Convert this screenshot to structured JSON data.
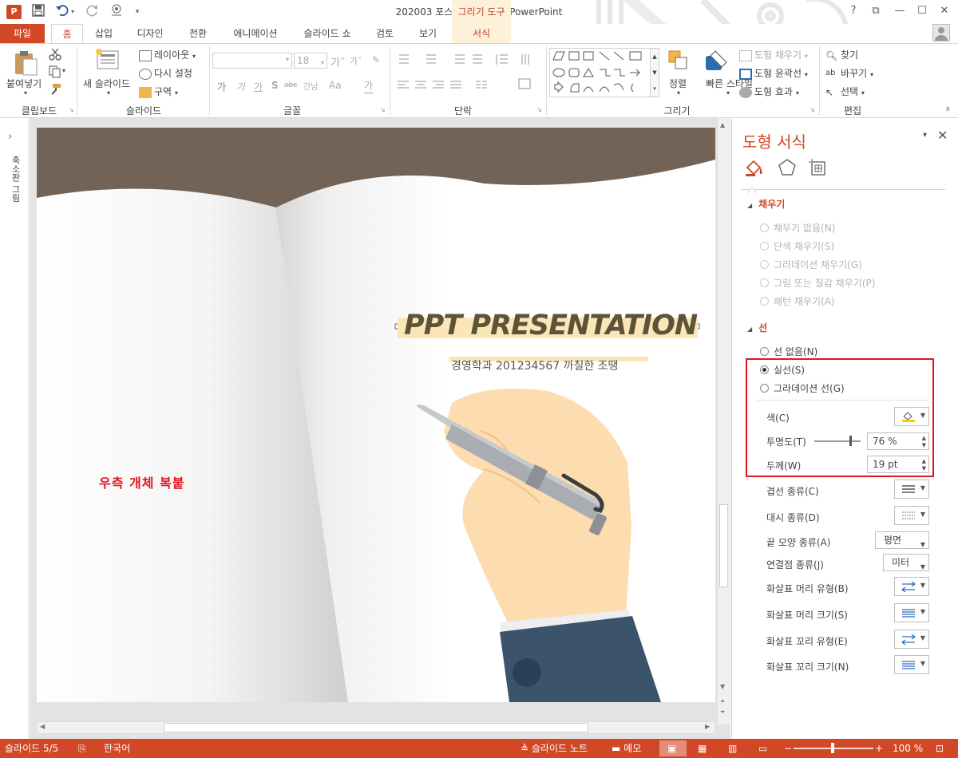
{
  "window": {
    "title": "202003 포스팅용 완성본 - PowerPoint",
    "app_icon": "P",
    "contextual_tab_header": "그리기 도구",
    "controls": [
      "?",
      "⧉",
      "—",
      "☐",
      "✕"
    ]
  },
  "quick_access": {
    "icons": [
      "save-icon",
      "undo-icon",
      "redo-icon",
      "touch-mode-icon",
      "customize-icon"
    ]
  },
  "tabs": {
    "file": "파일",
    "home": "홈",
    "insert": "삽입",
    "design": "디자인",
    "transitions": "전환",
    "animations": "애니메이션",
    "slideshow": "슬라이드 쇼",
    "review": "검토",
    "view": "보기",
    "format": "서식",
    "active": "홈"
  },
  "ribbon": {
    "clipboard": {
      "label": "클립보드",
      "paste": "붙여넣기"
    },
    "slides": {
      "label": "슬라이드",
      "new_slide": "새 슬라이드",
      "layout": "레이아웃",
      "reset": "다시 설정",
      "section": "구역"
    },
    "font": {
      "label": "글꼴",
      "font_name": "",
      "font_size": "18",
      "bold": "가",
      "italic": "가",
      "underline": "가",
      "shadow": "S",
      "strike": "abc",
      "spacing": "간남",
      "case": "Aa",
      "color": "가"
    },
    "paragraph": {
      "label": "단락"
    },
    "drawing": {
      "label": "그리기",
      "arrange": "정렬",
      "quick_styles": "빠른 스타일",
      "shape_fill": "도형 채우기",
      "shape_outline": "도형 윤곽선",
      "shape_effects": "도형 효과"
    },
    "editing": {
      "label": "편집",
      "find": "찾기",
      "replace": "바꾸기",
      "select": "선택"
    }
  },
  "thumbnail_pane": {
    "label": "축소판 그림"
  },
  "slide": {
    "title": "PPT PRESENTATION",
    "subtitle": "경영학과 201234567 까칠한 조땡",
    "note_text": "우측 개체 복붙",
    "colors": {
      "top_band": "#736357",
      "title_color": "#5c5339",
      "title_highlight": "#fbe6b7",
      "note_color": "#e0161f",
      "skin": "#fddcb0",
      "sleeve": "#3b546c"
    }
  },
  "format_pane": {
    "title": "도형 서식",
    "tab_icons": [
      "fill-line-icon",
      "effects-pentagon-icon",
      "size-properties-icon"
    ],
    "fill_section": {
      "heading": "채우기",
      "options": [
        "채우기 없음(N)",
        "단색 채우기(S)",
        "그라데이션 채우기(G)",
        "그림 또는 질감 채우기(P)",
        "패턴 채우기(A)"
      ]
    },
    "line_section": {
      "heading": "선",
      "options": [
        "선 없음(N)",
        "실선(S)",
        "그라데이션 선(G)"
      ],
      "selected": "실선(S)",
      "color_label": "색(C)",
      "transparency_label": "투명도(T)",
      "transparency_value": "76 %",
      "transparency_fraction": 0.76,
      "width_label": "두께(W)",
      "width_value": "19 pt",
      "compound_label": "겹선 종류(C)",
      "dash_label": "대시 종류(D)",
      "cap_label": "끝 모양 종류(A)",
      "cap_value": "평면",
      "join_label": "연결점 종류(J)",
      "join_value": "미터",
      "begin_arrow_type_label": "화살표 머리 유형(B)",
      "begin_arrow_size_label": "화살표 머리 크기(S)",
      "end_arrow_type_label": "화살표 꼬리 유형(E)",
      "end_arrow_size_label": "화살표 꼬리 크기(N)"
    }
  },
  "status": {
    "slide_indicator": "슬라이드 5/5",
    "language": "한국어",
    "notes": "슬라이드 노트",
    "comments": "메모",
    "zoom": "100 %"
  },
  "accent_color": "#d24726"
}
